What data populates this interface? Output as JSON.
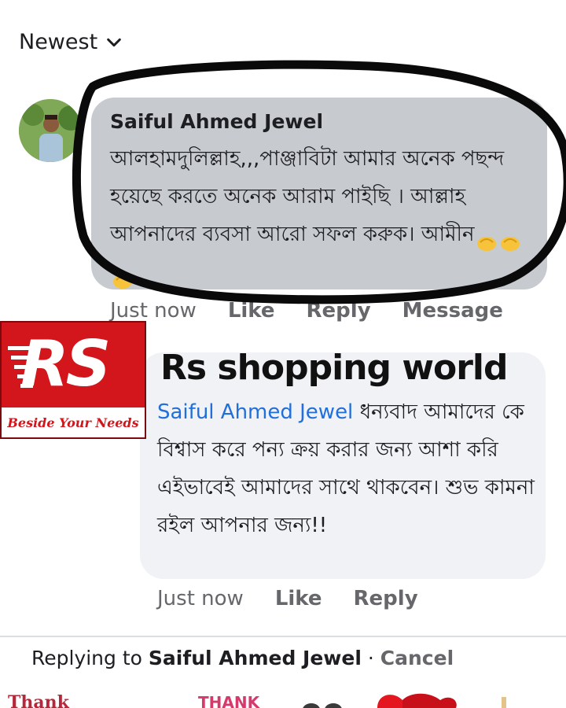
{
  "sort": {
    "label": "Newest"
  },
  "comment": {
    "author": "Saiful Ahmed Jewel",
    "text": "আলহামদুলিল্লাহ,,,পাঞ্জাবিটা আমার অনেক পছন্দ হয়েছে করতে অনেক আরাম পাইছি । আল্লাহ আপনাদের ব্যবসা আরো সফল করুক। আমীন",
    "timestamp": "Just now",
    "like": "Like",
    "reply": "Reply",
    "message": "Message"
  },
  "reply": {
    "page_name": "Rs shopping world",
    "mention": "Saiful Ahmed Jewel",
    "text": "ধন্যবাদ আমাদের কে বিশ্বাস করে পন্য ক্রয় করার জন্য আশা করি এইভাবেই আমাদের সাথে থাকবেন। শুভ কামনা রইল আপনার জন্য!!",
    "timestamp": "Just now",
    "like": "Like",
    "reply": "Reply"
  },
  "logo": {
    "initials": "RS",
    "tagline": "Beside Your Needs"
  },
  "replying_bar": {
    "prefix": "Replying to",
    "name": "Saiful Ahmed Jewel",
    "separator": " · ",
    "cancel": "Cancel"
  },
  "sticker_strip": {
    "thank": "THANK"
  },
  "colors": {
    "bubble_gray": "#c7cace",
    "bubble_light": "#f0f2f5",
    "mention_blue": "#216fdb",
    "logo_red": "#d3151c",
    "muted": "#65676b"
  },
  "icons": [
    "chevron-down-icon",
    "folded-hands-emoji",
    "heart-sticker"
  ]
}
